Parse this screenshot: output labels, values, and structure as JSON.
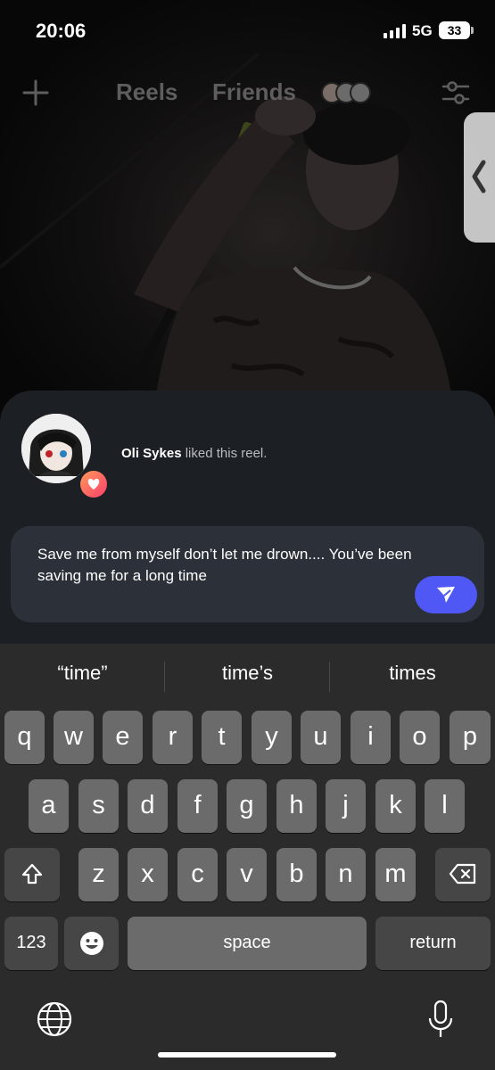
{
  "status_bar": {
    "time": "20:06",
    "network": "5G",
    "battery": "33"
  },
  "top_nav": {
    "tabs": [
      {
        "label": "Reels"
      },
      {
        "label": "Friends"
      }
    ],
    "icons": {
      "create": "plus-icon",
      "filter": "sliders-icon",
      "side": "chevron-left-icon"
    }
  },
  "notification": {
    "user": "Oli Sykes",
    "action": " liked this reel."
  },
  "message": {
    "text": "Save me from myself don’t let me drown.... You’ve been saving me for a long time",
    "send_icon": "send-icon"
  },
  "keyboard": {
    "suggestions": [
      "“time”",
      "time’s",
      "times"
    ],
    "rows": [
      [
        "q",
        "w",
        "e",
        "r",
        "t",
        "y",
        "u",
        "i",
        "o",
        "p"
      ],
      [
        "a",
        "s",
        "d",
        "f",
        "g",
        "h",
        "j",
        "k",
        "l"
      ],
      [
        "z",
        "x",
        "c",
        "v",
        "b",
        "n",
        "m"
      ]
    ],
    "numbers_label": "123",
    "space_label": "space",
    "return_label": "return",
    "icons": {
      "shift": "shift-icon",
      "backspace": "backspace-icon",
      "emoji": "emoji-icon",
      "globe": "globe-icon",
      "mic": "microphone-icon"
    }
  },
  "colors": {
    "accent": "#4f58f5",
    "sheet": "#1c1f24",
    "keyboard": "#2b2b2b"
  }
}
